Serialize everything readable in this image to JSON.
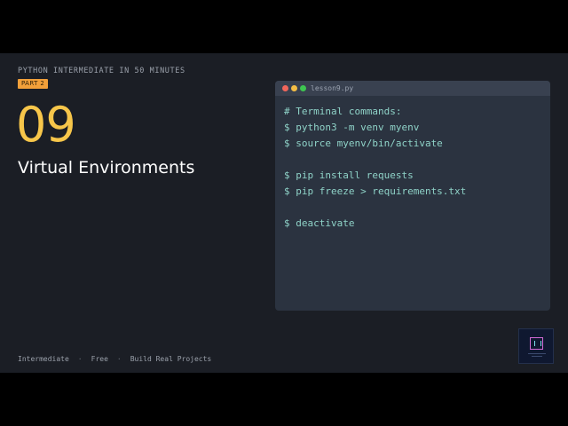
{
  "slide": {
    "course_title": "PYTHON INTERMEDIATE IN 50 MINUTES",
    "part_badge": "PART 2",
    "lesson_number": "09",
    "lesson_title": "Virtual Environments"
  },
  "editor": {
    "filename": "lesson9.py",
    "lines": [
      "# Terminal commands:",
      "$ python3 -m venv myenv",
      "$ source myenv/bin/activate",
      "",
      "$ pip install requests",
      "$ pip freeze > requirements.txt",
      "",
      "$ deactivate"
    ]
  },
  "footer": {
    "items": [
      "Intermediate",
      "Free",
      "Build Real Projects"
    ],
    "separator": "·"
  },
  "colors": {
    "accent_yellow": "#f7c64a",
    "badge_orange": "#f2a03a",
    "code_text": "#8fd3c8",
    "slide_background": "#1b1e25"
  },
  "icons": {
    "logo": "brand-logo-icon"
  }
}
